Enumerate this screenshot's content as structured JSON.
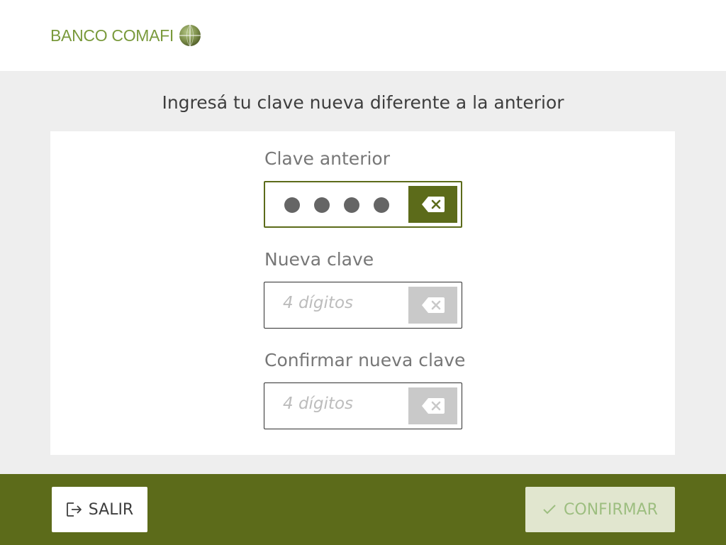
{
  "header": {
    "brand_name": "BANCO COMAFI",
    "logo_icon": "globe-icon",
    "brand_color": "#7a9a3c"
  },
  "instruction": "Ingresá tu clave nueva diferente a la anterior",
  "fields": [
    {
      "label": "Clave anterior",
      "state": "active",
      "entered_digits": 4,
      "placeholder": "",
      "clear_icon": "backspace-icon"
    },
    {
      "label": "Nueva clave",
      "state": "empty",
      "entered_digits": 0,
      "placeholder": "4 dígitos",
      "clear_icon": "backspace-icon"
    },
    {
      "label": "Confirmar nueva clave",
      "state": "empty",
      "entered_digits": 0,
      "placeholder": "4 dígitos",
      "clear_icon": "backspace-icon"
    }
  ],
  "footer": {
    "exit_label": "SALIR",
    "exit_icon": "logout-icon",
    "confirm_label": "CONFIRMAR",
    "confirm_icon": "check-icon",
    "confirm_enabled": false
  },
  "colors": {
    "primary": "#5c6b1a",
    "background": "#eeeeee",
    "disabled_button": "#e1e6cf",
    "disabled_text": "#9dbe80"
  }
}
